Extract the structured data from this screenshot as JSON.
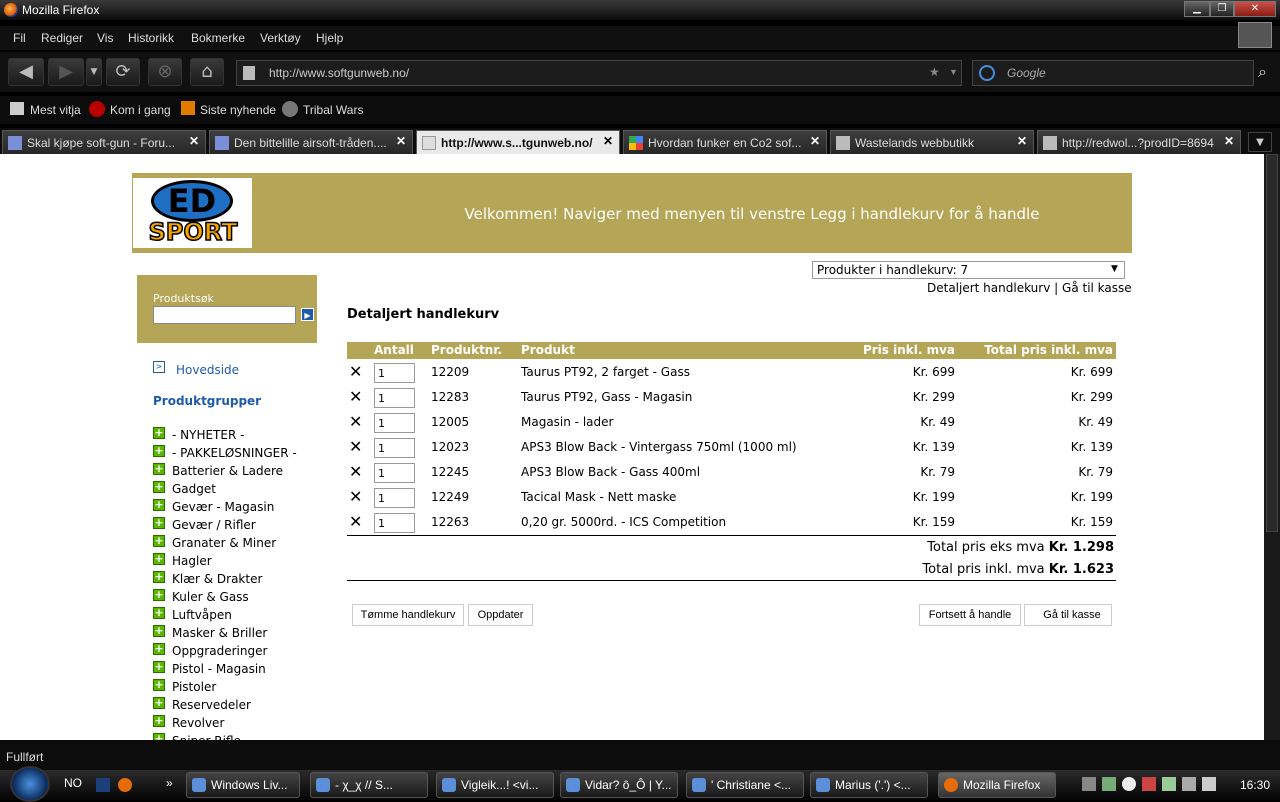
{
  "window": {
    "title": "Mozilla Firefox",
    "min": "▁",
    "max": "❐",
    "close": "✕"
  },
  "menu": [
    "Fil",
    "Rediger",
    "Vis",
    "Historikk",
    "Bokmerke",
    "Verktøy",
    "Hjelp"
  ],
  "url": "http://www.softgunweb.no/",
  "search_placeholder": "Google",
  "bookmarks": [
    "Mest vitja",
    "Kom i gang",
    "Siste nyhende",
    "Tribal Wars"
  ],
  "tabs": [
    {
      "label": "Skal kjøpe soft-gun - Foru...",
      "close": "✕"
    },
    {
      "label": "Den bittelille airsoft-tråden....",
      "close": "✕"
    },
    {
      "label": "http://www.s...tgunweb.no/",
      "close": "✕",
      "active": true
    },
    {
      "label": "Hvordan funker en Co2 sof...",
      "close": "✕"
    },
    {
      "label": "Wastelands webbutikk",
      "close": "✕"
    },
    {
      "label": "http://redwol...?prodID=8694",
      "close": "✕"
    }
  ],
  "page": {
    "logo": {
      "top": "ED",
      "bottom": "SPORT"
    },
    "welcome": "Velkommen! Naviger med menyen til venstre Legg i handlekurv for å handle",
    "search_label": "Produktsøk",
    "home_link": "Hovedside",
    "groups_title": "Produktgrupper",
    "categories": [
      "- NYHETER -",
      "- PAKKELØSNINGER -",
      "Batterier & Ladere",
      "Gadget",
      "Gevær - Magasin",
      "Gevær / Rifler",
      "Granater & Miner",
      "Hagler",
      "Klær & Drakter",
      "Kuler & Gass",
      "Luftvåpen",
      "Masker & Briller",
      "Oppgraderinger",
      "Pistol - Magasin",
      "Pistoler",
      "Reservedeler",
      "Revolver",
      "Sniper Rifle"
    ],
    "cart_select": "Produkter i handlekurv: 7",
    "cart_links": {
      "detailed": "Detaljert handlekurv",
      "sep": "|",
      "checkout": "Gå til kasse"
    },
    "section_title": "Detaljert handlekurv",
    "table_headers": {
      "qty": "Antall",
      "prodno": "Produktnr.",
      "product": "Produkt",
      "price": "Pris inkl. mva",
      "total": "Total pris inkl. mva"
    },
    "rows": [
      {
        "qty": "1",
        "prodno": "12209",
        "product": "Taurus PT92, 2 farget - Gass",
        "price": "Kr. 699",
        "total": "Kr. 699"
      },
      {
        "qty": "1",
        "prodno": "12283",
        "product": "Taurus PT92, Gass - Magasin",
        "price": "Kr. 299",
        "total": "Kr. 299"
      },
      {
        "qty": "1",
        "prodno": "12005",
        "product": "Magasin - lader",
        "price": "Kr. 49",
        "total": "Kr. 49"
      },
      {
        "qty": "1",
        "prodno": "12023",
        "product": "APS3 Blow Back - Vintergass 750ml (1000 ml)",
        "price": "Kr. 139",
        "total": "Kr. 139"
      },
      {
        "qty": "1",
        "prodno": "12245",
        "product": "APS3 Blow Back - Gass 400ml",
        "price": "Kr. 79",
        "total": "Kr. 79"
      },
      {
        "qty": "1",
        "prodno": "12249",
        "product": "Tacical Mask - Nett maske",
        "price": "Kr. 199",
        "total": "Kr. 199"
      },
      {
        "qty": "1",
        "prodno": "12263",
        "product": "0,20 gr. 5000rd. - ICS Competition",
        "price": "Kr. 159",
        "total": "Kr. 159"
      }
    ],
    "totals": {
      "ex_label": "Total pris eks mva",
      "ex_value": "Kr. 1.298",
      "inc_label": "Total pris inkl. mva",
      "inc_value": "Kr. 1.623"
    },
    "buttons": {
      "empty": "Tømme handlekurv",
      "update": "Oppdater",
      "continue": "Fortsett å handle",
      "checkout": "Gå til kasse"
    }
  },
  "status": "Fullført",
  "taskbar": {
    "lang": "NO",
    "tasks": [
      "Windows Liv...",
      "- χ_χ // S...",
      "Vigleik...! <vi...",
      "Vidar? ô_Ô | Y...",
      "' Christiane <...",
      "Marius ('.') <...",
      "Mozilla Firefox"
    ],
    "clock": "16:30"
  }
}
